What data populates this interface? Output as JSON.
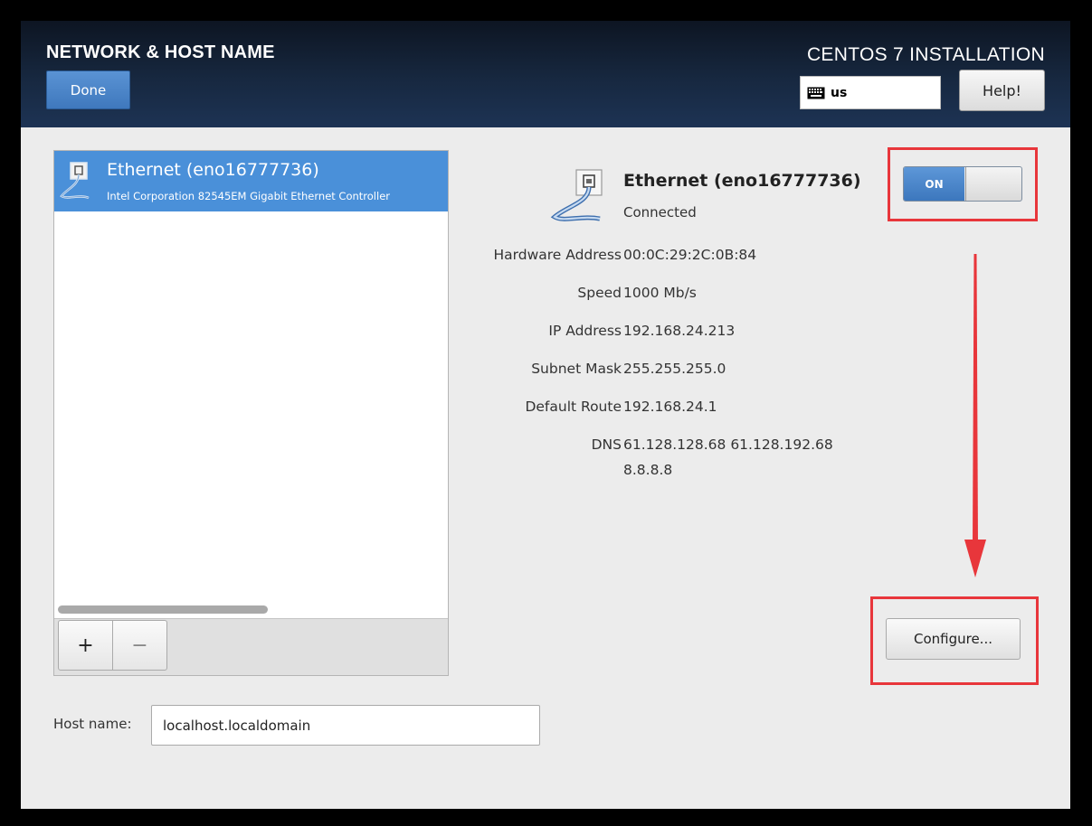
{
  "header": {
    "page_title": "NETWORK & HOST NAME",
    "done_label": "Done",
    "installer_title": "CENTOS 7 INSTALLATION",
    "keyboard_layout": "us",
    "help_label": "Help!"
  },
  "device_list": {
    "items": [
      {
        "name": "Ethernet (eno16777736)",
        "description": "Intel Corporation 82545EM Gigabit Ethernet Controller",
        "selected": true
      }
    ],
    "add_label": "+",
    "remove_label": "−"
  },
  "details": {
    "name": "Ethernet (eno16777736)",
    "status": "Connected",
    "toggle_label": "ON",
    "toggle_on": true,
    "properties": [
      {
        "label": "Hardware Address",
        "value": "00:0C:29:2C:0B:84"
      },
      {
        "label": "Speed",
        "value": "1000 Mb/s"
      },
      {
        "label": "IP Address",
        "value": "192.168.24.213"
      },
      {
        "label": "Subnet Mask",
        "value": "255.255.255.0"
      },
      {
        "label": "Default Route",
        "value": "192.168.24.1"
      },
      {
        "label": "DNS",
        "value": "61.128.128.68 61.128.192.68",
        "value2": "8.8.8.8"
      }
    ],
    "configure_label": "Configure..."
  },
  "hostname": {
    "label": "Host name:",
    "value": "localhost.localdomain"
  },
  "colors": {
    "header_bg": "#172840",
    "accent_blue": "#4a90d9",
    "annotation_red": "#e8363b"
  }
}
